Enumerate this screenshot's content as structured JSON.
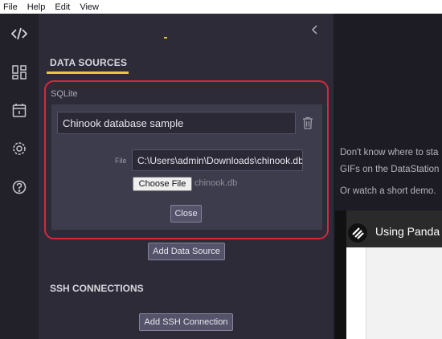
{
  "menu": {
    "file": "File",
    "help": "Help",
    "edit": "Edit",
    "view": "View"
  },
  "sidebar_icons": [
    "code-icon",
    "dashboard-icon",
    "calendar-icon",
    "settings-icon",
    "help-icon"
  ],
  "panel": {
    "data_sources_title": "DATA SOURCES",
    "source_type": "SQLite",
    "source_name": "Chinook database sample",
    "file_label": "File",
    "file_path": "C:\\Users\\admin\\Downloads\\chinook.db",
    "choose_file_label": "Choose File",
    "chosen_file_name": "chinook.db",
    "close_label": "Close",
    "add_data_source_label": "Add Data Source",
    "ssh_title": "SSH CONNECTIONS",
    "add_ssh_label": "Add SSH Connection"
  },
  "right_panel": {
    "help_line_1": "Don't know where to sta",
    "help_line_2": "GIFs on the DataStation",
    "help_line_3": "Or watch a short demo.",
    "video_title": "Using Panda"
  },
  "colors": {
    "accent_yellow": "#e8c53a",
    "highlight_red": "#d7283a"
  }
}
